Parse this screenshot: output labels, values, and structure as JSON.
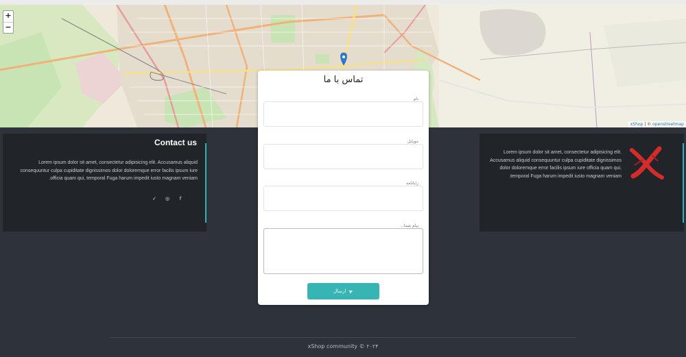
{
  "map": {
    "zoom_in": "+",
    "zoom_out": "−",
    "attribution_brand": "xShop",
    "attribution_separator": " | © ",
    "attribution_source": "openstreetmap",
    "colors": {
      "land": "#efe9dc",
      "park": "#c9e4b4",
      "road_major": "#f0b27a",
      "road_yellow": "#f7e08a",
      "marker": "#2a7ad2"
    }
  },
  "contact_card": {
    "title": "Contact us",
    "text": "Lorem ipsum dolor sit amet, consectetur adipisicing elit. Accusamus aliquid consequuntur culpa cupiditate dignissimos dolor doloremque error facilis ipsum iure officia quam qui, temporal Fuga harum impedit iusto magnam veniam.",
    "socials": [
      {
        "icon": "facebook-icon",
        "glyph": "f"
      },
      {
        "icon": "instagram-icon",
        "glyph": "◎"
      },
      {
        "icon": "twitter-icon",
        "glyph": "✓"
      }
    ]
  },
  "about_card": {
    "text": "Lorem ipsum dolor sit amet, consectetur adipisicing elit. Accusamus aliquid consequuntur culpa cupiditate dignissimos dolor doloremque error facilis ipsum iure officia quam qui, temporal Fuga harum impedit iusto magnam veniam.",
    "logo_color": "#d42b2b"
  },
  "form": {
    "title": "تماس با ما",
    "name_label": "نام",
    "mobile_label": "موبایل",
    "email_label": "رایانامه",
    "message_label": "پیام شما...",
    "submit_label": "ارسال",
    "accent": "#37b4b4"
  },
  "footer": {
    "text": "xShop community © ۲۰۲۴"
  }
}
